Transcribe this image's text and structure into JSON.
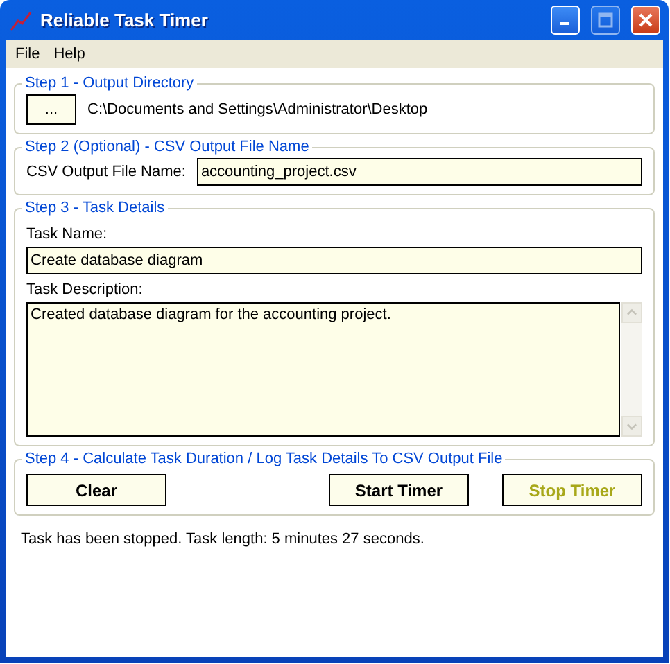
{
  "window": {
    "title": "Reliable Task Timer"
  },
  "menu": [
    "File",
    "Help"
  ],
  "step1": {
    "legend": "Step 1 - Output Directory",
    "browse": "...",
    "path": "C:\\Documents and Settings\\Administrator\\Desktop"
  },
  "step2": {
    "legend": "Step 2 (Optional) - CSV Output File Name",
    "label": "CSV Output File Name:",
    "value": "accounting_project.csv"
  },
  "step3": {
    "legend": "Step 3 - Task Details",
    "name_label": "Task Name:",
    "name_value": "Create database diagram",
    "desc_label": "Task Description:",
    "desc_value": "Created database diagram for the accounting project."
  },
  "step4": {
    "legend": "Step 4 - Calculate Task Duration / Log Task Details To CSV Output File",
    "buttons": [
      {
        "label": "Clear",
        "disabled": false
      },
      {
        "label": "Start Timer",
        "disabled": false
      },
      {
        "label": "Stop Timer",
        "disabled": true
      }
    ]
  },
  "status": "Task has been stopped. Task length: 5 minutes 27 seconds."
}
